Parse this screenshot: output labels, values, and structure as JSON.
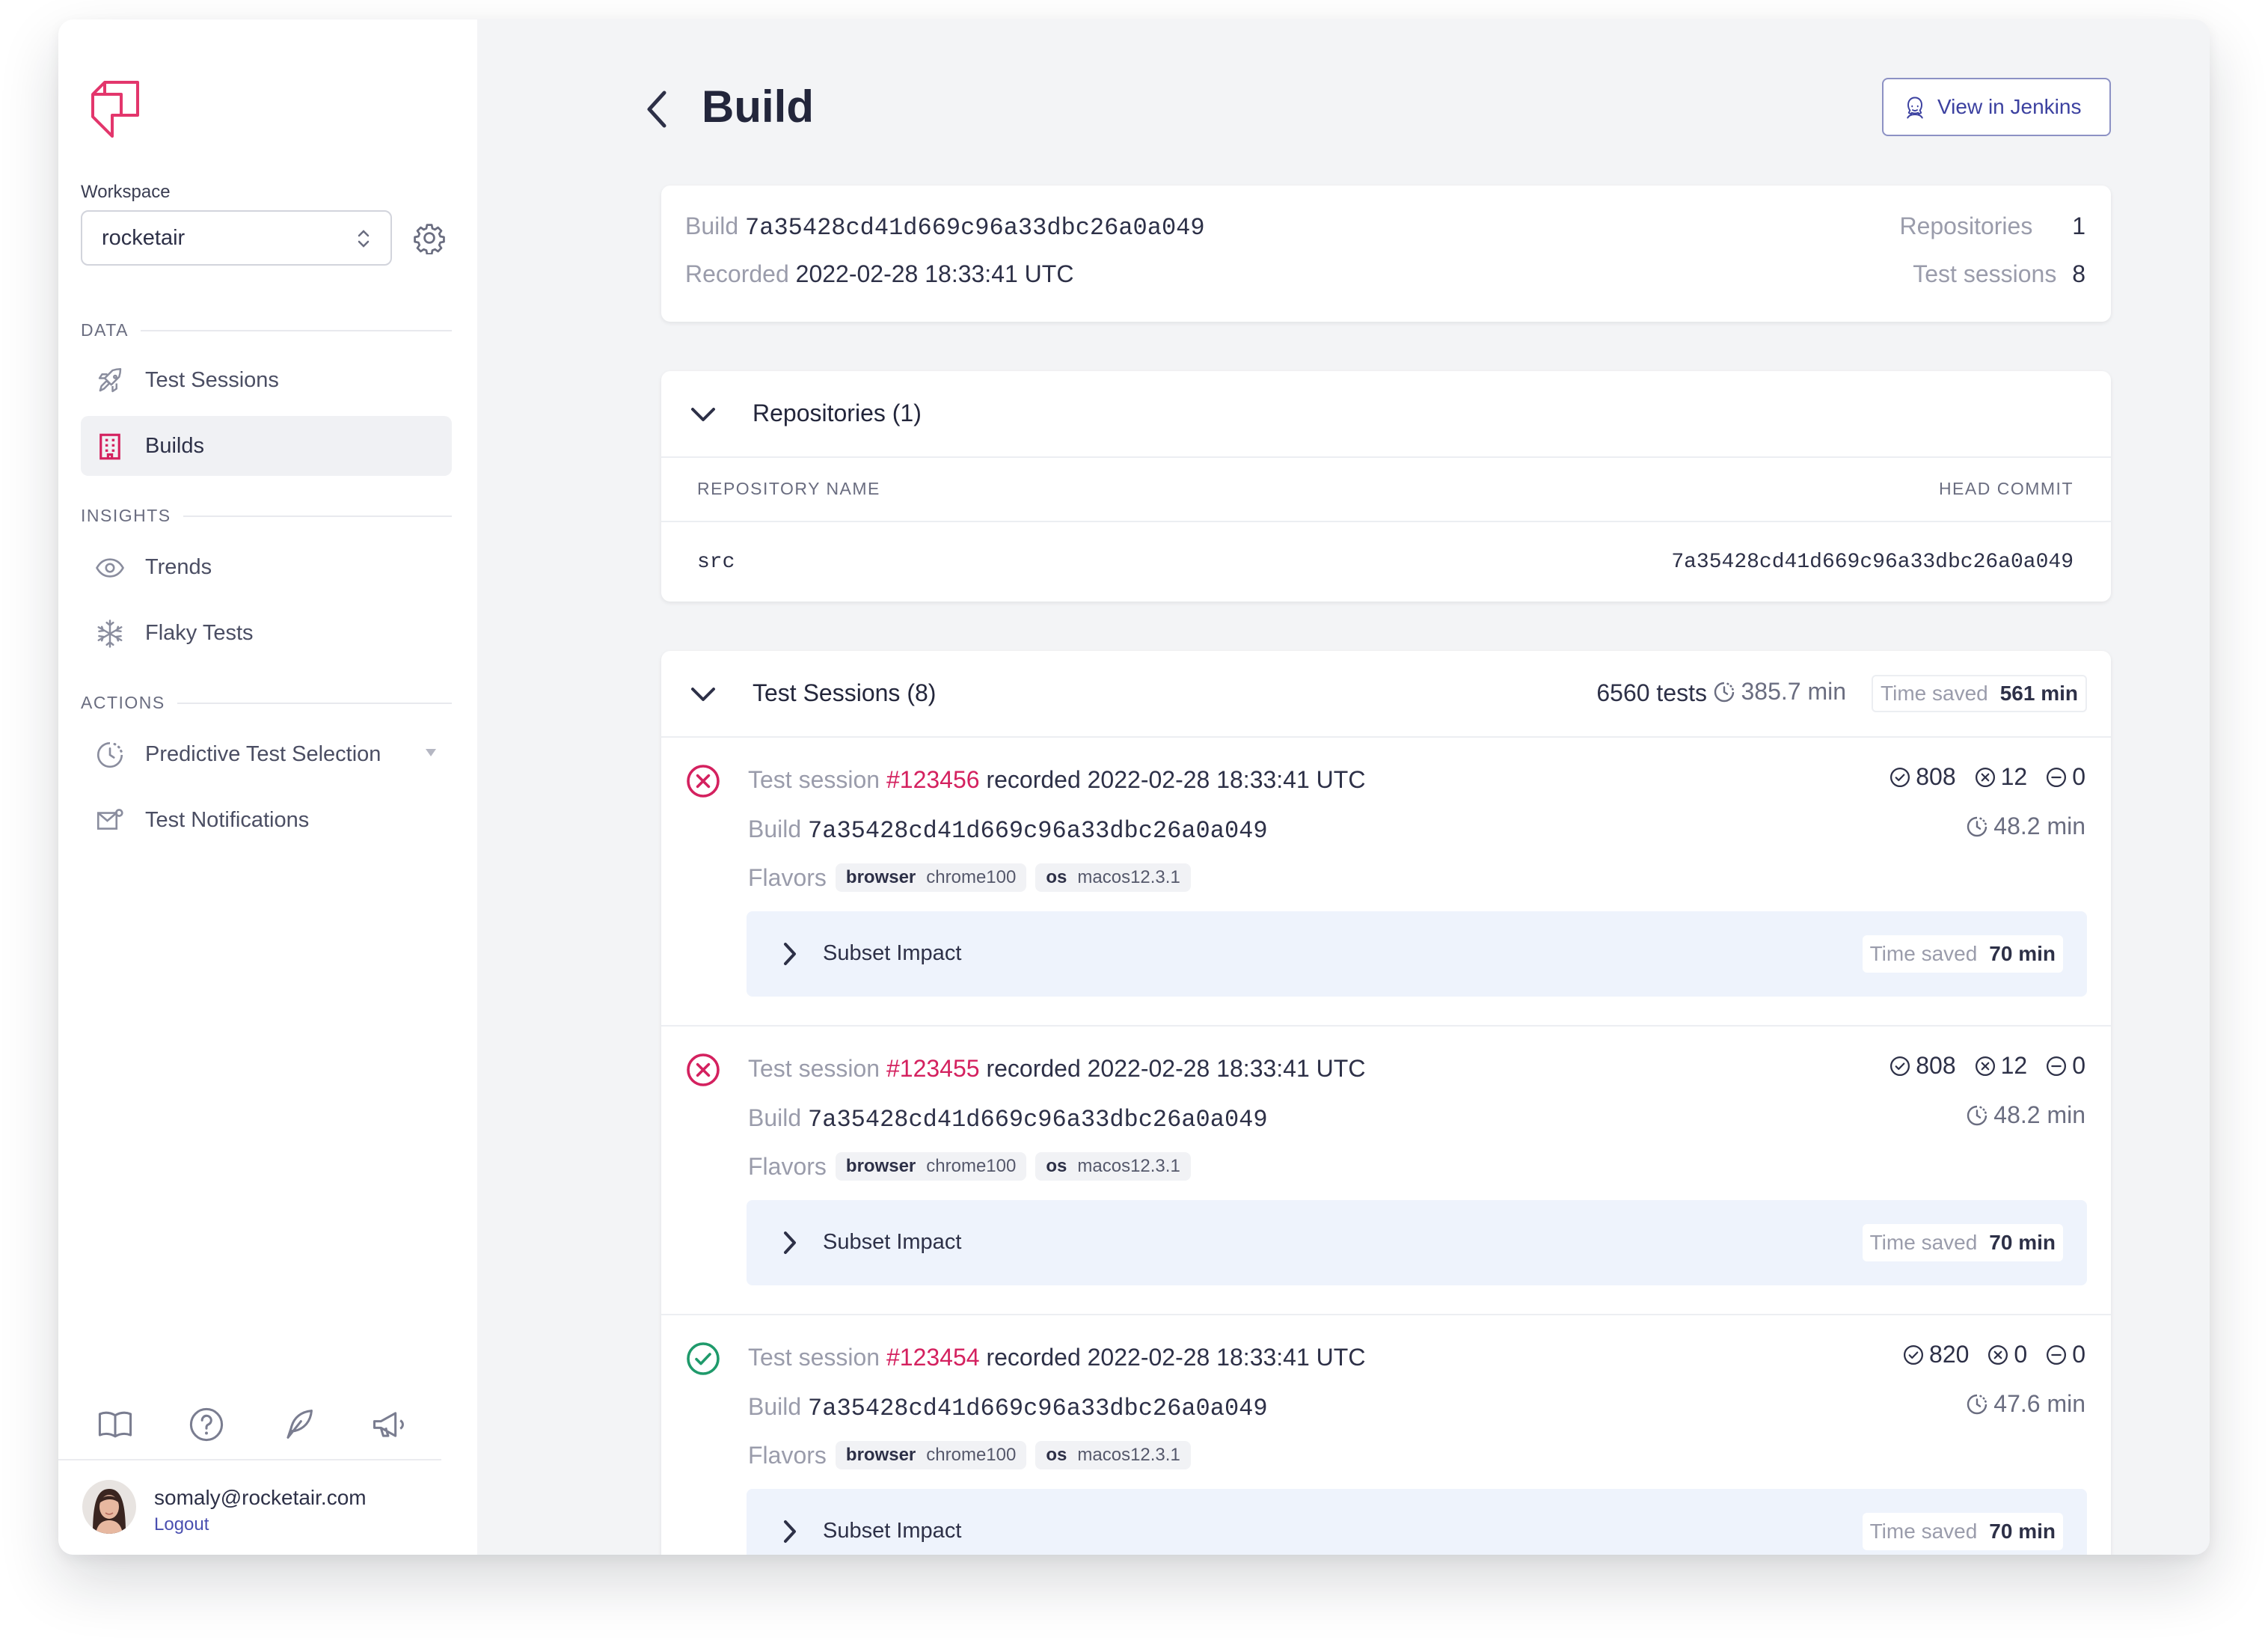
{
  "workspace": {
    "label": "Workspace",
    "selected": "rocketair"
  },
  "sidebar": {
    "sections": {
      "data": "DATA",
      "insights": "INSIGHTS",
      "actions": "ACTIONS"
    },
    "items": {
      "test_sessions": "Test Sessions",
      "builds": "Builds",
      "trends": "Trends",
      "flaky_tests": "Flaky Tests",
      "predictive": "Predictive Test Selection",
      "notifications": "Test Notifications"
    },
    "active_item": "Builds"
  },
  "user": {
    "email": "somaly@rocketair.com",
    "logout": "Logout"
  },
  "header": {
    "title": "Build",
    "jenkins_button": "View in Jenkins"
  },
  "summary": {
    "build_label": "Build",
    "build_id": "7a35428cd41d669c96a33dbc26a0a049",
    "recorded_label": "Recorded",
    "recorded_value": "2022-02-28 18:33:41 UTC",
    "repositories_label": "Repositories",
    "repositories_value": "1",
    "test_sessions_label": "Test sessions",
    "test_sessions_value": "8"
  },
  "repositories": {
    "title": "Repositories (1)",
    "col_name": "REPOSITORY NAME",
    "col_commit": "HEAD COMMIT",
    "rows": [
      {
        "name": "src",
        "commit": "7a35428cd41d669c96a33dbc26a0a049"
      }
    ]
  },
  "test_sessions": {
    "title": "Test Sessions (8)",
    "tests": "6560 tests",
    "duration": "385.7 min",
    "time_saved_label": "Time saved",
    "time_saved_value": "561 min",
    "labels": {
      "session": "Test session",
      "recorded": "recorded",
      "build": "Build",
      "flavors": "Flavors",
      "subset": "Subset Impact",
      "time_saved": "Time saved"
    },
    "sessions": [
      {
        "status": "failed",
        "id": "#123456",
        "recorded": "2022-02-28 18:33:41 UTC",
        "build": "7a35428cd41d669c96a33dbc26a0a049",
        "flavors": [
          {
            "key": "browser",
            "value": "chrome100"
          },
          {
            "key": "os",
            "value": "macos12.3.1"
          }
        ],
        "passed": "808",
        "failed": "12",
        "skipped": "0",
        "duration": "48.2 min",
        "time_saved": "70 min"
      },
      {
        "status": "failed",
        "id": "#123455",
        "recorded": "2022-02-28 18:33:41 UTC",
        "build": "7a35428cd41d669c96a33dbc26a0a049",
        "flavors": [
          {
            "key": "browser",
            "value": "chrome100"
          },
          {
            "key": "os",
            "value": "macos12.3.1"
          }
        ],
        "passed": "808",
        "failed": "12",
        "skipped": "0",
        "duration": "48.2 min",
        "time_saved": "70 min"
      },
      {
        "status": "passed",
        "id": "#123454",
        "recorded": "2022-02-28 18:33:41 UTC",
        "build": "7a35428cd41d669c96a33dbc26a0a049",
        "flavors": [
          {
            "key": "browser",
            "value": "chrome100"
          },
          {
            "key": "os",
            "value": "macos12.3.1"
          }
        ],
        "passed": "820",
        "failed": "0",
        "skipped": "0",
        "duration": "47.6 min",
        "time_saved": "70 min"
      }
    ]
  },
  "colors": {
    "accent_pink": "#d4215f",
    "success_green": "#1f9a6b",
    "link_blue": "#3c41a0",
    "subset_bg": "#eef3fc"
  },
  "icons": {
    "logo": "launchable-logo-icon",
    "settings": "gear-icon",
    "back": "chevron-left-icon",
    "jenkins": "jenkins-icon",
    "footer": [
      "book-icon",
      "help-icon",
      "feather-icon",
      "megaphone-icon"
    ]
  }
}
